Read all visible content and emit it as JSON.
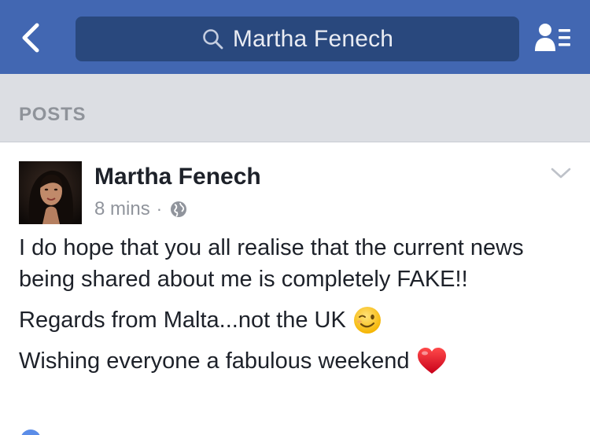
{
  "header": {
    "search_query": "Martha Fenech",
    "back_icon": "chevron-left-icon",
    "search_icon": "magnifier-icon",
    "friends_icon": "friends-list-icon",
    "bar_color": "#4267b2",
    "search_bg": "#29487d"
  },
  "section": {
    "title": "POSTS"
  },
  "post": {
    "author": "Martha Fenech",
    "time": "8 mins",
    "separator": "·",
    "privacy_icon": "globe-icon",
    "menu_icon": "chevron-down-icon",
    "paragraphs": [
      "I do hope that you all realise that the current news being shared about me is completely FAKE!!",
      "Regards from Malta...not the UK",
      "Wishing everyone a fabulous weekend"
    ],
    "emoji": [
      "winking-face",
      "red-heart"
    ]
  }
}
